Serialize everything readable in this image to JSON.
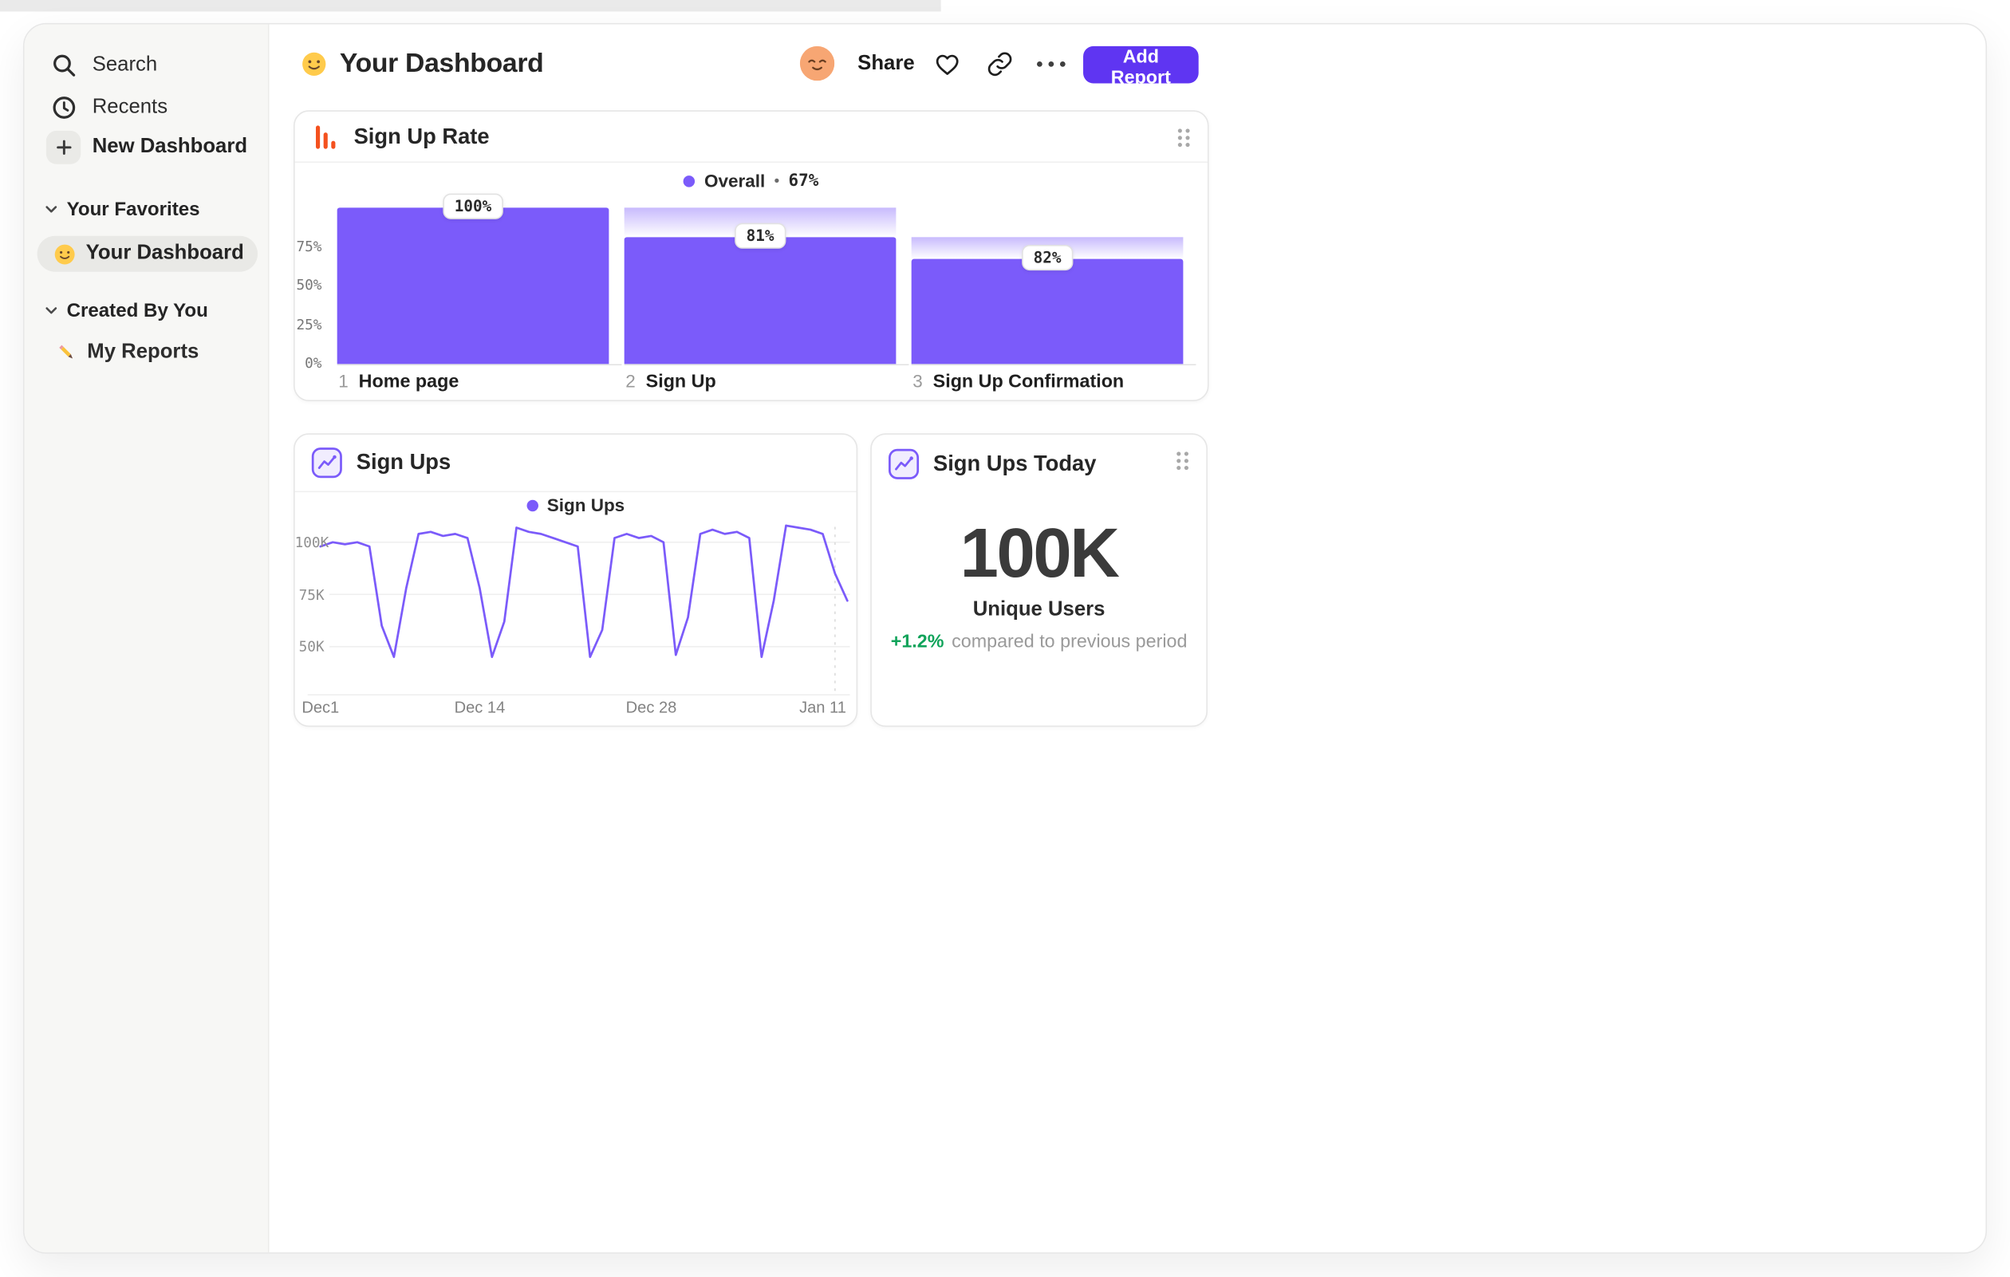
{
  "sidebar": {
    "nav": [
      {
        "label": "Search",
        "icon": "search-icon"
      },
      {
        "label": "Recents",
        "icon": "clock-icon"
      },
      {
        "label": "New Dashboard",
        "icon": "plus-icon"
      }
    ],
    "sections": [
      {
        "title": "Your Favorites",
        "items": [
          {
            "icon": "smiley-emoji",
            "label": "Your Dashboard",
            "selected": true
          }
        ]
      },
      {
        "title": "Created By You",
        "items": [
          {
            "icon": "pencil-emoji",
            "label": "My Reports",
            "selected": false
          }
        ]
      }
    ]
  },
  "header": {
    "title_emoji": "slightly-smiling-face",
    "title": "Your Dashboard",
    "avatar": "relieved-face",
    "share_label": "Share",
    "add_report_label": "Add Report"
  },
  "colors": {
    "accent_purple": "#7B5BFA",
    "button_purple": "#5F35F2",
    "funnel_icon_orange": "#F4511E",
    "positive_green": "#10A35A"
  },
  "chart_data": [
    {
      "type": "bar",
      "variant": "funnel",
      "title": "Sign Up Rate",
      "legend": {
        "series": "Overall",
        "separator": "•",
        "value": "67%"
      },
      "yticks": [
        "75%",
        "50%",
        "25%",
        "0%"
      ],
      "ylim": [
        0,
        108
      ],
      "steps": [
        {
          "num": "1",
          "label": "Home page",
          "display_pct": "100%",
          "overall_pct": 100
        },
        {
          "num": "2",
          "label": "Sign Up",
          "display_pct": "81%",
          "overall_pct": 81
        },
        {
          "num": "3",
          "label": "Sign Up Confirmation",
          "display_pct": "82%",
          "overall_pct": 67
        }
      ]
    },
    {
      "type": "line",
      "title": "Sign Ups",
      "legend": "Sign Ups",
      "yticks": [
        {
          "label": "100K",
          "value": 100
        },
        {
          "label": "75K",
          "value": 75
        },
        {
          "label": "50K",
          "value": 50
        }
      ],
      "xticks": [
        {
          "label": "Dec1",
          "day": 0
        },
        {
          "label": "Dec 14",
          "day": 13
        },
        {
          "label": "Dec 28",
          "day": 27
        },
        {
          "label": "Jan 11",
          "day": 41
        }
      ],
      "ylim_k": [
        40,
        112
      ],
      "series": [
        {
          "name": "Sign Ups",
          "unit": "K",
          "values_by_day": [
            98,
            100,
            99,
            100,
            98,
            60,
            45,
            78,
            104,
            105,
            103,
            104,
            102,
            78,
            45,
            62,
            107,
            105,
            104,
            102,
            100,
            98,
            45,
            58,
            102,
            104,
            102,
            103,
            100,
            46,
            64,
            104,
            106,
            104,
            105,
            102,
            45,
            72,
            108,
            107,
            106,
            104,
            85,
            72
          ]
        }
      ]
    },
    {
      "type": "number",
      "title": "Sign Ups Today",
      "value": "100K",
      "metric_label": "Unique Users",
      "delta": "+1.2%",
      "delta_note": "compared to previous period"
    }
  ]
}
